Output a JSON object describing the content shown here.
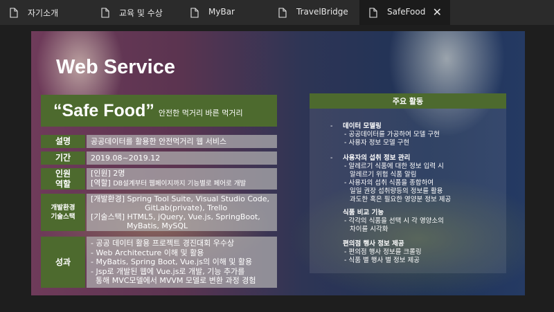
{
  "tabs": [
    {
      "label": "자기소개",
      "active": false
    },
    {
      "label": "교육 및 수상",
      "active": false
    },
    {
      "label": "MyBar",
      "active": false
    },
    {
      "label": "TravelBridge",
      "active": false
    },
    {
      "label": "SafeFood",
      "active": true
    }
  ],
  "tab_close_glyph": "✕",
  "slide": {
    "title": "Web Service",
    "banner_title": "“Safe Food”",
    "banner_subtitle": "안전한 먹거리 바른 먹거리",
    "rows": {
      "desc": {
        "label": "설명",
        "value": "공공데이터를 활용한 안전먹거리 웹 서비스"
      },
      "period": {
        "label": "기간",
        "value": "2019.08~2019.12"
      },
      "role": {
        "label_1": "인원",
        "label_2": "역할",
        "line_1": "[인원] 2명",
        "line_2_prefix": "[역할]",
        "line_2_text": "DB설계부터 웹페이지까지 기능별로 페어로 개발"
      },
      "stack": {
        "label_1": "개발환경",
        "label_2": "기술스택",
        "line_1": "[개발환경] Spring Tool Suite, Visual Studio Code,",
        "line_2": "GitLab(private), Trello",
        "line_3": "[기술스택] HTML5, jQuery, Vue.js, SpringBoot,",
        "line_4": "MyBatis, MySQL"
      },
      "result": {
        "label": "성과",
        "lines": [
          "- 공공 데이터 활용 프로젝트 경진대회 우수상",
          "- Web Architecture 이해 및 활용",
          "- MyBatis, Spring Boot, Vue.js의 이해 및 활용",
          "- Jsp로 개발된 웹에 Vue.js로 개발, 기능 추가를",
          "  통해 MVC모델에서 MVVM 모델로 변환 과정 경험"
        ]
      }
    },
    "activities": {
      "header": "주요 활동",
      "bullet": "-",
      "items": [
        {
          "title": "데이터 모델링",
          "lines": [
            "- 공공데이터를 가공하여 모델 구현",
            "- 사용자 정보 모델 구현"
          ]
        },
        {
          "title": "사용자의 섭취 정보 관리",
          "lines": [
            "- 알레르기 식품에 대한 정보 입력 시",
            "알레르기 위험 식품 알림",
            "- 사용자의 섭취 식품을 종합하여",
            "일일 권장 섭취량등의 정보를 활용",
            "과도한 혹은 필요한 영양분 정보 제공"
          ]
        },
        {
          "title": "식품 비교 기능",
          "lines": [
            "- 각각의 식품을 선택 시 각 영양소의",
            "차이를 시각화"
          ]
        },
        {
          "title": "편의점 행사 정보 제공",
          "lines": [
            "- 편의점 행사 정보를 크롤링",
            "- 식품 별 행사 별 정보 제공"
          ]
        }
      ]
    }
  }
}
